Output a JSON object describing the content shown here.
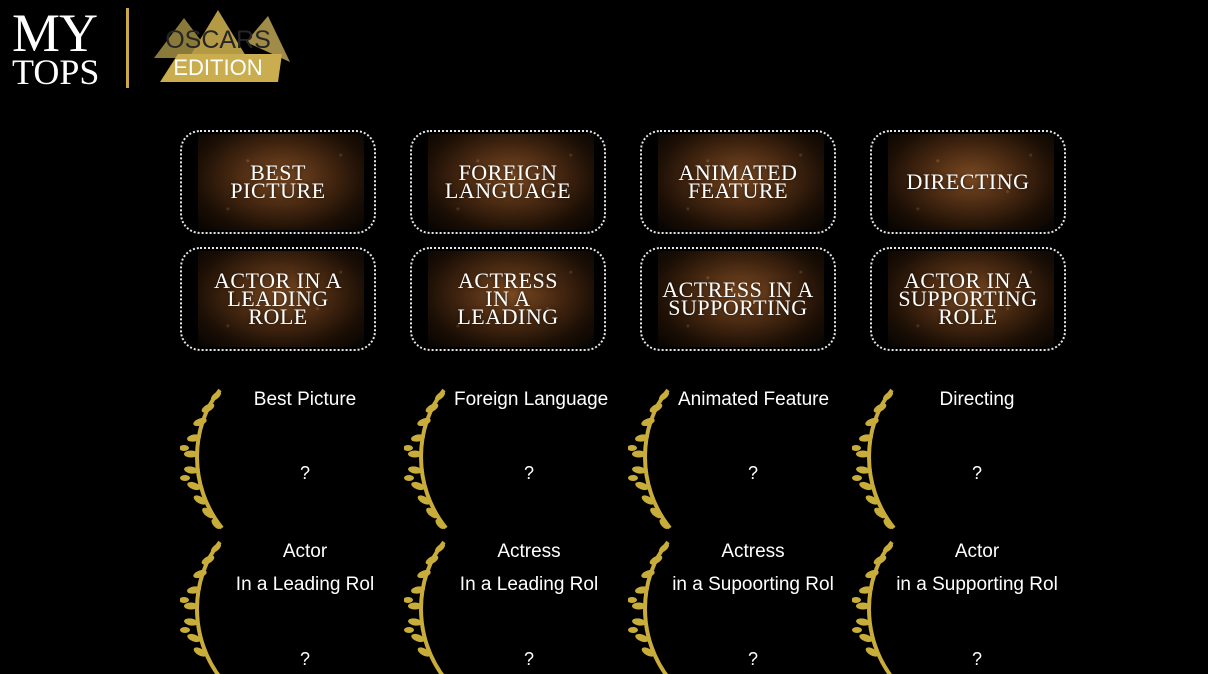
{
  "header": {
    "logo_line1": "MY",
    "logo_line2": "TOPS",
    "badge_line1": "OSCARS",
    "badge_line2": "EDITION",
    "accent_color": "#c8a94c"
  },
  "categories": [
    {
      "label": "BEST\nPICTURE"
    },
    {
      "label": "FOREIGN\nLANGUAGE"
    },
    {
      "label": "ANIMATED\nFEATURE"
    },
    {
      "label": "DIRECTING"
    },
    {
      "label": "ACTOR IN A\nLEADING\nROLE"
    },
    {
      "label": "ACTRESS\nIN A\nLEADING"
    },
    {
      "label": "ACTRESS IN A\nSUPPORTING"
    },
    {
      "label": "ACTOR IN A\nSUPPORTING\nROLE"
    }
  ],
  "nominees": [
    {
      "title": "Best Picture",
      "value": "?"
    },
    {
      "title": "Foreign Language",
      "value": "?"
    },
    {
      "title": "Animated Feature",
      "value": "?"
    },
    {
      "title": "Directing",
      "value": "?"
    },
    {
      "title": "Actor",
      "subtitle": "In a Leading Rol",
      "value": "?"
    },
    {
      "title": "Actress",
      "subtitle": "In a Leading Rol",
      "value": "?"
    },
    {
      "title": "Actress",
      "subtitle": "in a Supoorting Rol",
      "value": "?"
    },
    {
      "title": "Actor",
      "subtitle": "in a Supporting Rol",
      "value": "?"
    }
  ]
}
